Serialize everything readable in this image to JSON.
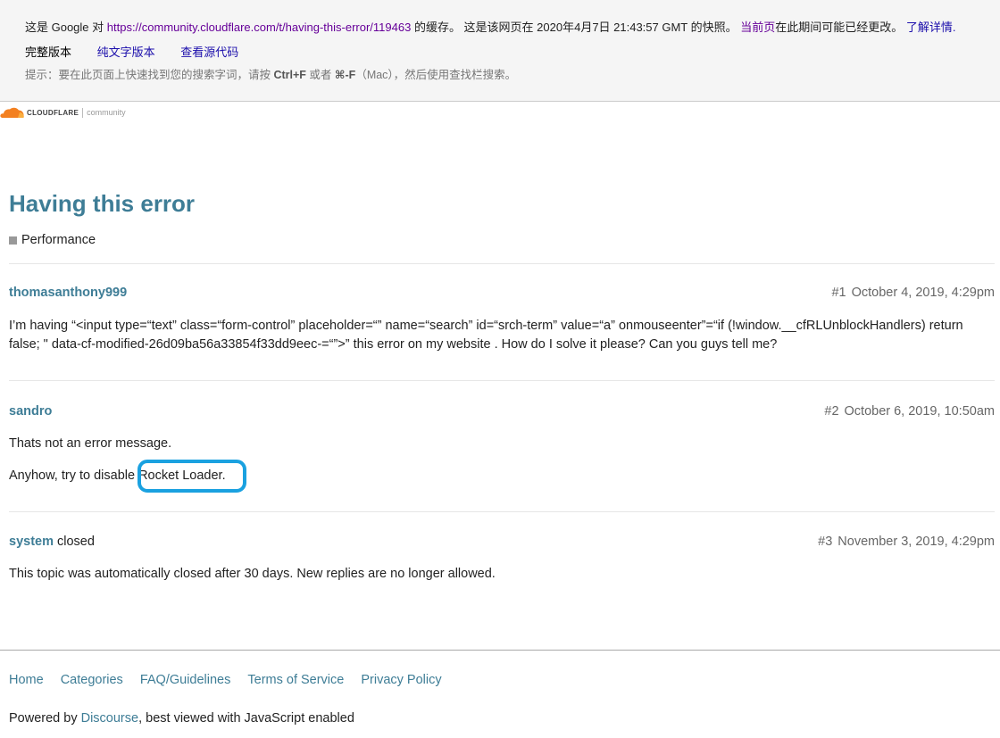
{
  "cache_banner": {
    "prefix": "这是 Google 对 ",
    "url": "https://community.cloudflare.com/t/having-this-error/119463",
    "mid": " 的缓存。 这是该网页在 2020年4月7日 21:43:57 GMT 的快照。 ",
    "current_page": "当前页",
    "suffix": "在此期间可能已经更改。 ",
    "learn_more": "了解详情",
    "learn_more_dot": ".",
    "version_full": "完整版本",
    "version_text": "纯文字版本",
    "view_source": "查看源代码",
    "tip_prefix": "提示：要在此页面上快速找到您的搜索字词，请按 ",
    "tip_key1": "Ctrl+F",
    "tip_mid": " 或者 ",
    "tip_key2": "⌘-F",
    "tip_suffix": "（Mac），然后使用查找栏搜索。"
  },
  "logo": {
    "brand": "CLOUDFLARE",
    "sub": "community",
    "colors": {
      "orange": "#f38020",
      "light_orange": "#faae40"
    }
  },
  "topic": {
    "title": "Having this error",
    "category": "Performance"
  },
  "posts": [
    {
      "author": "thomasanthony999",
      "author_extra": "",
      "number": "#1",
      "date": "October 4, 2019, 4:29pm",
      "paragraphs": [
        "I’m having “<input type=“text” class=“form-control” placeholder=“” name=“search” id=“srch-term” value=“a” onmouseenter”=“if (!window.__cfRLUnblockHandlers) return false; \" data-cf-modified-26d09ba56a33854f33dd9eec-=“”>” this error on my website . How do I solve it please? Can you guys tell me?"
      ]
    },
    {
      "author": "sandro",
      "author_extra": "",
      "number": "#2",
      "date": "October 6, 2019, 10:50am",
      "paragraphs": [
        "Thats not an error message.",
        "Anyhow, try to disable Rocket Loader."
      ]
    },
    {
      "author": "system",
      "author_extra": " closed",
      "number": "#3",
      "date": "November 3, 2019, 4:29pm",
      "paragraphs": [
        "This topic was automatically closed after 30 days. New replies are no longer allowed."
      ]
    }
  ],
  "footer": {
    "links": [
      "Home",
      "Categories",
      "FAQ/Guidelines",
      "Terms of Service",
      "Privacy Policy"
    ],
    "powered_prefix": "Powered by ",
    "powered_link": "Discourse",
    "powered_suffix": ", best viewed with JavaScript enabled"
  },
  "colors": {
    "link": "#3e7d96",
    "highlight_ring": "#1aa1e0"
  }
}
